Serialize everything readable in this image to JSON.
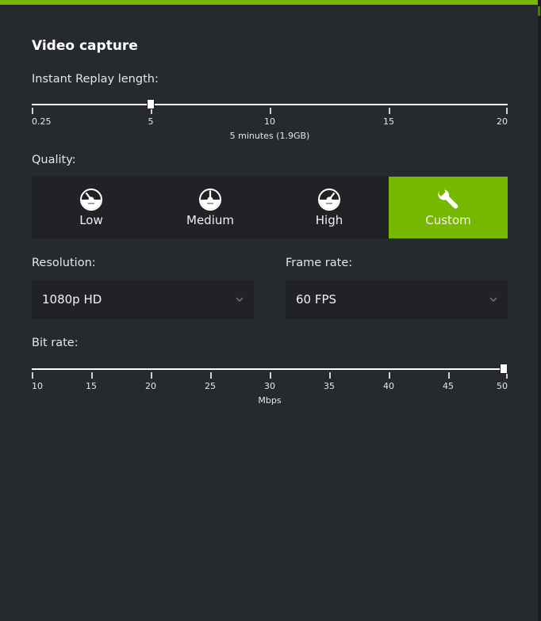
{
  "colors": {
    "accent": "#76b900",
    "background": "#262a2f",
    "control_bg": "#202226",
    "text": "#e6e6e6"
  },
  "section_title": "Video capture",
  "replay": {
    "label": "Instant Replay length:",
    "ticks": [
      "0.25",
      "5",
      "10",
      "15",
      "20"
    ],
    "tick_values": [
      0.25,
      5,
      10,
      15,
      20
    ],
    "min": 0.25,
    "max": 20,
    "value": 5,
    "caption": "5 minutes (1.9GB)"
  },
  "quality": {
    "label": "Quality:",
    "options": [
      {
        "label": "Low",
        "icon": "speedometer-low-icon",
        "selected": false
      },
      {
        "label": "Medium",
        "icon": "speedometer-medium-icon",
        "selected": false
      },
      {
        "label": "High",
        "icon": "speedometer-high-icon",
        "selected": false
      },
      {
        "label": "Custom",
        "icon": "wrench-icon",
        "selected": true
      }
    ]
  },
  "resolution": {
    "label": "Resolution:",
    "value": "1080p HD"
  },
  "frame_rate": {
    "label": "Frame rate:",
    "value": "60 FPS"
  },
  "bitrate": {
    "label": "Bit rate:",
    "ticks": [
      "10",
      "15",
      "20",
      "25",
      "30",
      "35",
      "40",
      "45",
      "50"
    ],
    "tick_values": [
      10,
      15,
      20,
      25,
      30,
      35,
      40,
      45,
      50
    ],
    "min": 10,
    "max": 50,
    "value": 50,
    "unit": "Mbps"
  }
}
